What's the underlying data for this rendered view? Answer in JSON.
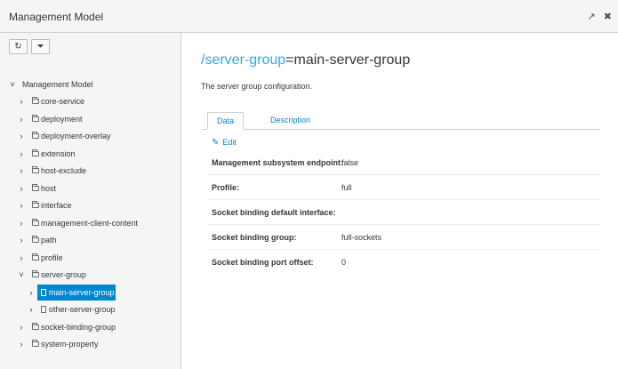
{
  "window": {
    "title": "Management Model",
    "icon_expand": "↗",
    "icon_close": "✖"
  },
  "toolbar": {
    "refresh_icon": "↻",
    "filter_icon": "⏷"
  },
  "tree": {
    "root": "Management Model",
    "children": [
      {
        "label": "core-service",
        "icon": "folder-icon"
      },
      {
        "label": "deployment",
        "icon": "folder-icon"
      },
      {
        "label": "deployment-overlay",
        "icon": "folder-icon"
      },
      {
        "label": "extension",
        "icon": "folder-icon"
      },
      {
        "label": "host-exclude",
        "icon": "folder-icon"
      },
      {
        "label": "host",
        "icon": "folder-icon"
      },
      {
        "label": "interface",
        "icon": "folder-icon"
      },
      {
        "label": "management-client-content",
        "icon": "folder-icon"
      },
      {
        "label": "path",
        "icon": "folder-icon"
      },
      {
        "label": "profile",
        "icon": "folder-icon"
      },
      {
        "label": "server-group",
        "icon": "folder-icon",
        "expanded": true
      },
      {
        "label": "main-server-group",
        "icon": "file-icon",
        "selected": true
      },
      {
        "label": "other-server-group",
        "icon": "file-icon"
      },
      {
        "label": "socket-binding-group",
        "icon": "folder-icon"
      },
      {
        "label": "system-property",
        "icon": "folder-icon"
      }
    ]
  },
  "main": {
    "heading_prefix": "/",
    "heading_segment": "server-group",
    "heading_suffix": "=main-server-group",
    "description": "The server group configuration.",
    "tabs": [
      {
        "label": "Data",
        "active": true
      },
      {
        "label": "Description",
        "active": false
      }
    ],
    "edit_label": "Edit",
    "attributes": [
      {
        "key": "Management subsystem endpoint:",
        "value": "false"
      },
      {
        "key": "Profile:",
        "value": "full"
      },
      {
        "key": "Socket binding default interface:",
        "value": ""
      },
      {
        "key": "Socket binding group:",
        "value": "full-sockets"
      },
      {
        "key": "Socket binding port offset:",
        "value": "0"
      }
    ]
  },
  "colors": {
    "accent": "#0088ce",
    "heading_link": "#39a5dc",
    "panel_bg": "#f5f5f5"
  }
}
